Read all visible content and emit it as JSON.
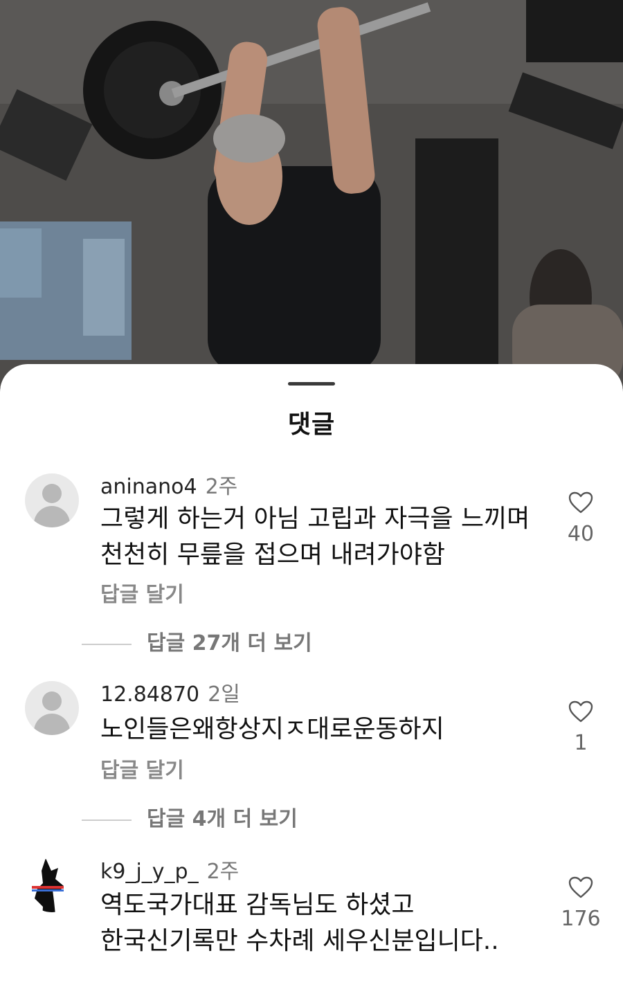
{
  "sheet": {
    "title": "댓글"
  },
  "comments": [
    {
      "user": "aninano4",
      "time": "2주",
      "lines": [
        "그렇게 하는거 아님 고립과 자극을 느끼며",
        "천천히 무릎을 접으며 내려가야함"
      ],
      "reply_label": "답글 달기",
      "more_label": "답글 27개 더 보기",
      "likes": "40",
      "avatar_icon": "default-user-icon"
    },
    {
      "user": "12.84870",
      "time": "2일",
      "lines": [
        "노인들은왜항상지ㅈ대로운동하지"
      ],
      "reply_label": "답글 달기",
      "more_label": "답글 4개 더 보기",
      "likes": "1",
      "avatar_icon": "default-user-icon"
    },
    {
      "user": "k9_j_y_p_",
      "time": "2주",
      "lines": [
        "역도국가대표 감독님도 하셨고",
        "한국신기록만 수차례 세우신분입니다.."
      ],
      "likes": "176",
      "avatar_icon": "dog-silhouette-icon"
    }
  ],
  "colors": {
    "sheet_bg": "#ffffff",
    "text": "#111111",
    "muted": "#888888"
  }
}
